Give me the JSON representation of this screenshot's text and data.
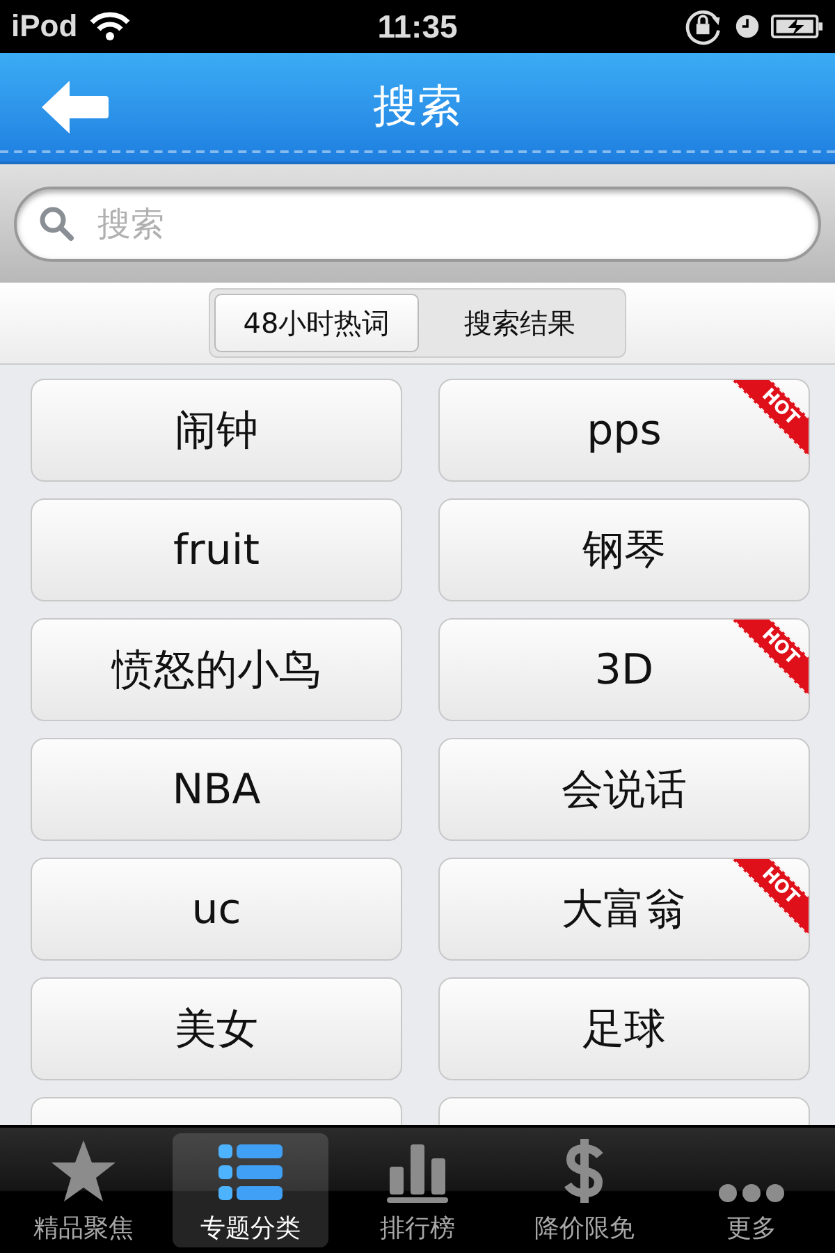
{
  "status_bar": {
    "carrier": "iPod",
    "time": "11:35"
  },
  "nav": {
    "title": "搜索"
  },
  "search": {
    "placeholder": "搜索"
  },
  "segments": [
    {
      "label": "48小时热词",
      "selected": true
    },
    {
      "label": "搜索结果",
      "selected": false
    }
  ],
  "keywords": [
    {
      "label": "闹钟",
      "hot": false
    },
    {
      "label": "pps",
      "hot": true,
      "badge": "HOT"
    },
    {
      "label": "fruit",
      "hot": false
    },
    {
      "label": "钢琴",
      "hot": false
    },
    {
      "label": "愤怒的小鸟",
      "hot": false
    },
    {
      "label": "3D",
      "hot": true,
      "badge": "HOT"
    },
    {
      "label": "NBA",
      "hot": false
    },
    {
      "label": "会说话",
      "hot": false
    },
    {
      "label": "uc",
      "hot": false
    },
    {
      "label": "大富翁",
      "hot": true,
      "badge": "HOT"
    },
    {
      "label": "美女",
      "hot": false
    },
    {
      "label": "足球",
      "hot": false
    }
  ],
  "tab_bar": [
    {
      "label": "精品聚焦",
      "kind": "star",
      "selected": false
    },
    {
      "label": "专题分类",
      "kind": "list",
      "selected": true
    },
    {
      "label": "排行榜",
      "kind": "bars",
      "selected": false
    },
    {
      "label": "降价限免",
      "kind": "dollar",
      "selected": false
    },
    {
      "label": "更多",
      "kind": "dots",
      "selected": false
    }
  ]
}
